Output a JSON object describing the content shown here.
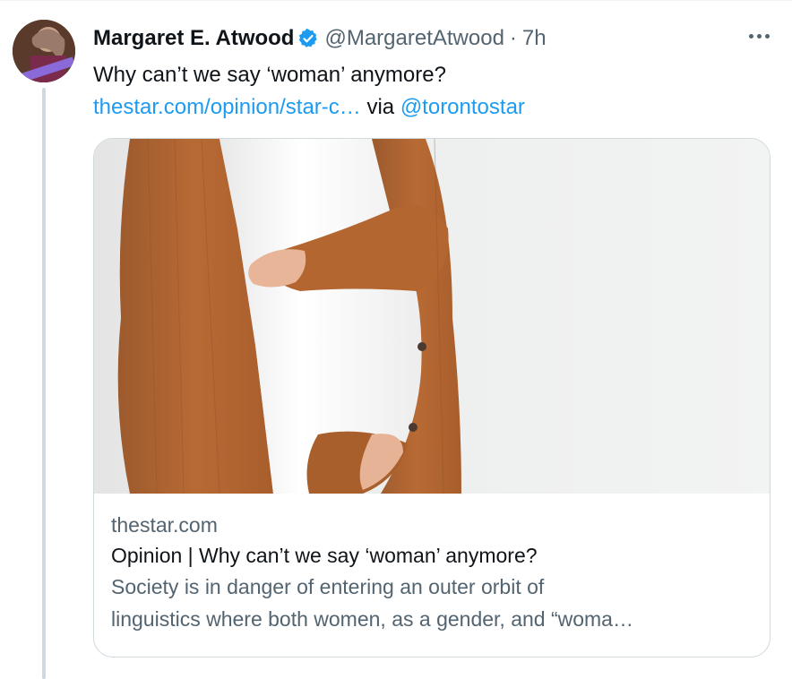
{
  "tweet": {
    "author": {
      "display_name": "Margaret E. Atwood",
      "handle": "@MargaretAtwood",
      "verified_icon": "verified-badge-icon"
    },
    "separator": "·",
    "time": "7h",
    "more_icon": "more-options-icon",
    "text": {
      "line1": "Why can’t we say ‘woman’ anymore?",
      "link_text": "thestar.com/opinion/star-c…",
      "via": " via ",
      "mention": "@torontostar"
    },
    "card": {
      "domain": "thestar.com",
      "title": "Opinion | Why can’t we say ‘woman’ anymore?",
      "description_line1": "Society is in danger of entering an outer orbit of",
      "description_line2": "linguistics where both women, as a gender, and “woma…"
    }
  },
  "colors": {
    "primary_text": "#0f1419",
    "secondary_text": "#536471",
    "link": "#1d9bf0",
    "border": "#cfd9de",
    "verified": "#1d9bf0"
  }
}
